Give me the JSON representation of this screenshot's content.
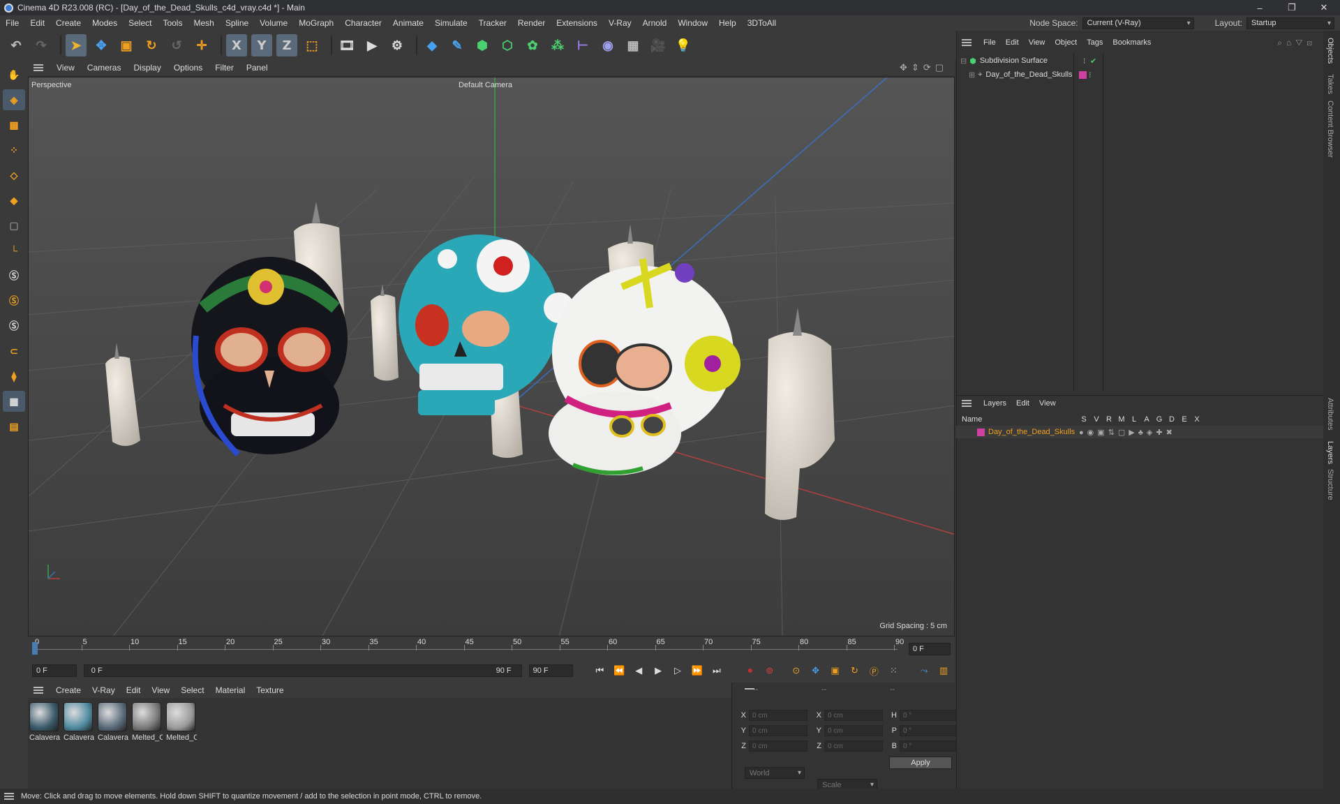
{
  "window": {
    "title": "Cinema 4D R23.008 (RC) - [Day_of_the_Dead_Skulls_c4d_vray.c4d *] - Main",
    "controls": [
      "–",
      "❐",
      "✕"
    ]
  },
  "menu": {
    "items": [
      "File",
      "Edit",
      "Create",
      "Modes",
      "Select",
      "Tools",
      "Mesh",
      "Spline",
      "Volume",
      "MoGraph",
      "Character",
      "Animate",
      "Simulate",
      "Tracker",
      "Render",
      "Extensions",
      "V-Ray",
      "Arnold",
      "Window",
      "Help",
      "3DToAll"
    ],
    "node_space_label": "Node Space:",
    "node_space_value": "Current (V-Ray)",
    "layout_label": "Layout:",
    "layout_value": "Startup"
  },
  "toolbar": {
    "icons": [
      "undo-icon",
      "redo-icon",
      "select-icon",
      "move-icon",
      "scale-icon",
      "rotate-icon",
      "recent-icon",
      "add-icon",
      "x-axis-icon",
      "y-axis-icon",
      "z-axis-icon",
      "coord-system-icon",
      "render-view-icon",
      "render-icon",
      "render-settings-icon",
      "cube-icon",
      "pen-icon",
      "subdivision-icon",
      "extrude-icon",
      "cloner-icon",
      "mograph-icon",
      "deformer-icon",
      "field-icon",
      "floor-icon",
      "camera-icon",
      "light-icon"
    ],
    "axis_labels": [
      "X",
      "Y",
      "Z"
    ]
  },
  "viewport": {
    "menu": [
      "View",
      "Cameras",
      "Display",
      "Options",
      "Filter",
      "Panel"
    ],
    "perspective_label": "Perspective",
    "camera_label": "Default Camera",
    "grid_spacing": "Grid Spacing : 5 cm"
  },
  "timeline": {
    "ticks": [
      "0",
      "5",
      "10",
      "15",
      "20",
      "25",
      "30",
      "35",
      "40",
      "45",
      "50",
      "55",
      "60",
      "65",
      "70",
      "75",
      "80",
      "85",
      "90"
    ],
    "current_frame": "0 F",
    "start_frame": "0 F",
    "range_start": "0 F",
    "range_end": "90 F",
    "end_frame": "90 F"
  },
  "materials": {
    "menu": [
      "Create",
      "V-Ray",
      "Edit",
      "View",
      "Select",
      "Material",
      "Texture"
    ],
    "items": [
      {
        "name": "Calavera",
        "color": "#3a5a6a"
      },
      {
        "name": "Calavera",
        "color": "#4f8aa0"
      },
      {
        "name": "Calavera",
        "color": "#5a6a7a"
      },
      {
        "name": "Melted_C",
        "color": "#7a7a7a"
      },
      {
        "name": "Melted_C",
        "color": "#9a9a9a"
      }
    ]
  },
  "coords": {
    "headers": [
      "--",
      "--",
      "--"
    ],
    "rows": [
      {
        "a": "X",
        "av": "0 cm",
        "b": "X",
        "bv": "0 cm",
        "c": "H",
        "cv": "0 °"
      },
      {
        "a": "Y",
        "av": "0 cm",
        "b": "Y",
        "bv": "0 cm",
        "c": "P",
        "cv": "0 °"
      },
      {
        "a": "Z",
        "av": "0 cm",
        "b": "Z",
        "bv": "0 cm",
        "c": "B",
        "cv": "0 °"
      }
    ],
    "space": "World",
    "mode": "Scale",
    "apply_label": "Apply"
  },
  "objects": {
    "menu": [
      "File",
      "Edit",
      "View",
      "Object",
      "Tags",
      "Bookmarks"
    ],
    "items": [
      "Subdivision Surface",
      "Day_of_the_Dead_Skulls"
    ]
  },
  "layers": {
    "menu": [
      "Layers",
      "Edit",
      "View"
    ],
    "name_header": "Name",
    "flags": [
      "S",
      "V",
      "R",
      "M",
      "L",
      "A",
      "G",
      "D",
      "E",
      "X"
    ],
    "items": [
      {
        "name": "Day_of_the_Dead_Skulls",
        "color": "#d040a0"
      }
    ]
  },
  "side_tabs": [
    "Objects",
    "Takes",
    "Content Browser",
    "Attributes",
    "Layers",
    "Structure"
  ],
  "status": {
    "text": "Move: Click and drag to move elements. Hold down SHIFT to quantize movement / add to the selection in point mode, CTRL to remove."
  },
  "colors": {
    "title_bg": "#2f3033",
    "panel": "#3a3a3a",
    "viewport": "#4a4a4a",
    "accent": "#3a7bd5"
  }
}
